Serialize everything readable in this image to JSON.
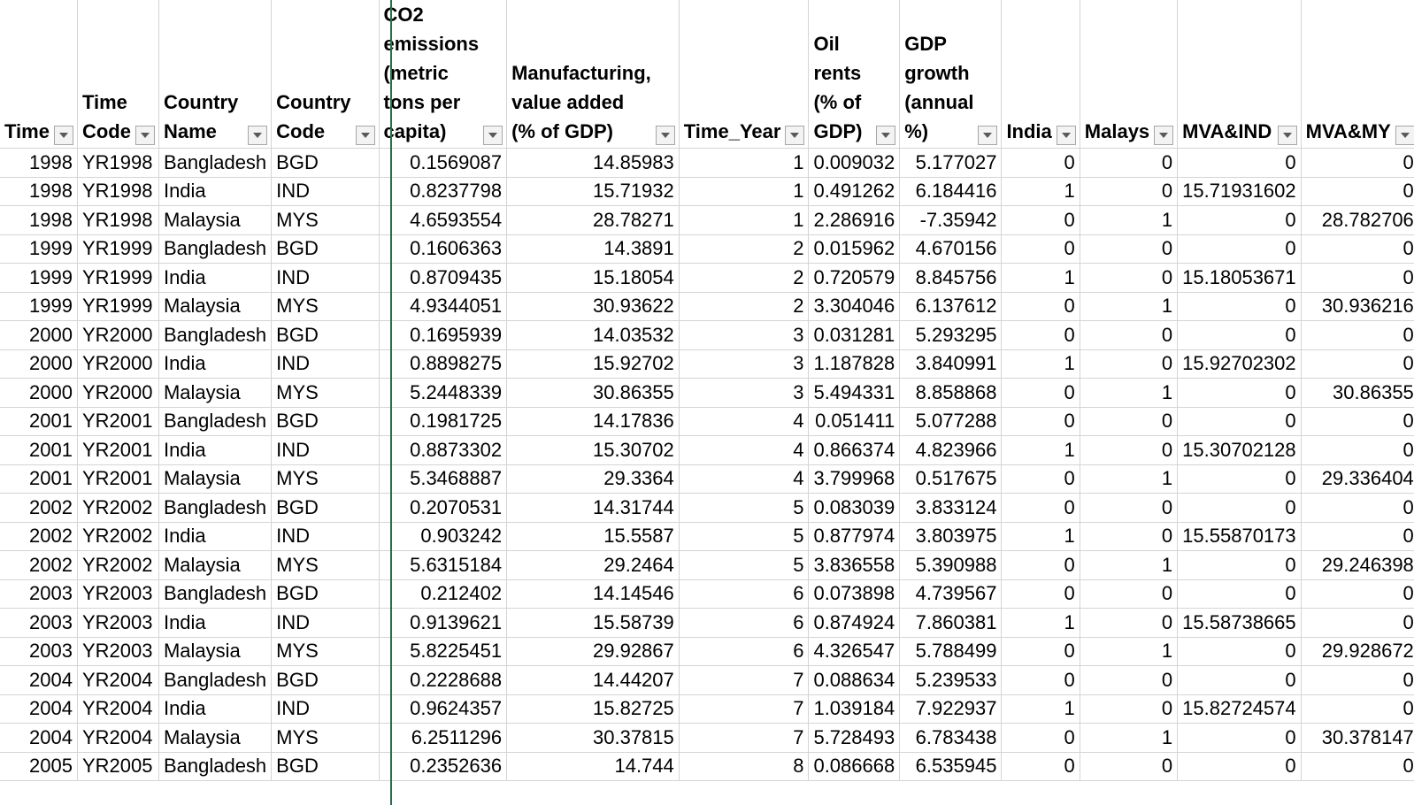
{
  "columns": [
    {
      "key": "time",
      "label": "Time",
      "align": "right"
    },
    {
      "key": "time_code",
      "label": "Time Code",
      "align": "left"
    },
    {
      "key": "country_name",
      "label": "Country Name",
      "align": "left"
    },
    {
      "key": "country_code",
      "label": "Country Code",
      "align": "left"
    },
    {
      "key": "co2",
      "label": "CO2 emissions (metric tons per capita)",
      "align": "right"
    },
    {
      "key": "manufacturing",
      "label": "Manufacturing, value added (% of GDP)",
      "align": "right"
    },
    {
      "key": "time_year",
      "label": "Time_Year",
      "align": "right"
    },
    {
      "key": "oil_rents",
      "label": "Oil rents (% of GDP)",
      "align": "right"
    },
    {
      "key": "gdp_growth",
      "label": "GDP growth (annual %)",
      "align": "right"
    },
    {
      "key": "india",
      "label": "India",
      "align": "right"
    },
    {
      "key": "malaysia",
      "label": "Malays",
      "align": "right"
    },
    {
      "key": "mva_ind",
      "label": "MVA&IND",
      "align": "right"
    },
    {
      "key": "mva_my",
      "label": "MVA&MY",
      "align": "right"
    }
  ],
  "rows": [
    [
      "1998",
      "YR1998",
      "Bangladesh",
      "BGD",
      "0.1569087",
      "14.85983",
      "1",
      "0.009032",
      "5.177027",
      "0",
      "0",
      "0",
      "0"
    ],
    [
      "1998",
      "YR1998",
      "India",
      "IND",
      "0.8237798",
      "15.71932",
      "1",
      "0.491262",
      "6.184416",
      "1",
      "0",
      "15.71931602",
      "0"
    ],
    [
      "1998",
      "YR1998",
      "Malaysia",
      "MYS",
      "4.6593554",
      "28.78271",
      "1",
      "2.286916",
      "-7.35942",
      "0",
      "1",
      "0",
      "28.782706"
    ],
    [
      "1999",
      "YR1999",
      "Bangladesh",
      "BGD",
      "0.1606363",
      "14.3891",
      "2",
      "0.015962",
      "4.670156",
      "0",
      "0",
      "0",
      "0"
    ],
    [
      "1999",
      "YR1999",
      "India",
      "IND",
      "0.8709435",
      "15.18054",
      "2",
      "0.720579",
      "8.845756",
      "1",
      "0",
      "15.18053671",
      "0"
    ],
    [
      "1999",
      "YR1999",
      "Malaysia",
      "MYS",
      "4.9344051",
      "30.93622",
      "2",
      "3.304046",
      "6.137612",
      "0",
      "1",
      "0",
      "30.936216"
    ],
    [
      "2000",
      "YR2000",
      "Bangladesh",
      "BGD",
      "0.1695939",
      "14.03532",
      "3",
      "0.031281",
      "5.293295",
      "0",
      "0",
      "0",
      "0"
    ],
    [
      "2000",
      "YR2000",
      "India",
      "IND",
      "0.8898275",
      "15.92702",
      "3",
      "1.187828",
      "3.840991",
      "1",
      "0",
      "15.92702302",
      "0"
    ],
    [
      "2000",
      "YR2000",
      "Malaysia",
      "MYS",
      "5.2448339",
      "30.86355",
      "3",
      "5.494331",
      "8.858868",
      "0",
      "1",
      "0",
      "30.86355"
    ],
    [
      "2001",
      "YR2001",
      "Bangladesh",
      "BGD",
      "0.1981725",
      "14.17836",
      "4",
      "0.051411",
      "5.077288",
      "0",
      "0",
      "0",
      "0"
    ],
    [
      "2001",
      "YR2001",
      "India",
      "IND",
      "0.8873302",
      "15.30702",
      "4",
      "0.866374",
      "4.823966",
      "1",
      "0",
      "15.30702128",
      "0"
    ],
    [
      "2001",
      "YR2001",
      "Malaysia",
      "MYS",
      "5.3468887",
      "29.3364",
      "4",
      "3.799968",
      "0.517675",
      "0",
      "1",
      "0",
      "29.336404"
    ],
    [
      "2002",
      "YR2002",
      "Bangladesh",
      "BGD",
      "0.2070531",
      "14.31744",
      "5",
      "0.083039",
      "3.833124",
      "0",
      "0",
      "0",
      "0"
    ],
    [
      "2002",
      "YR2002",
      "India",
      "IND",
      "0.903242",
      "15.5587",
      "5",
      "0.877974",
      "3.803975",
      "1",
      "0",
      "15.55870173",
      "0"
    ],
    [
      "2002",
      "YR2002",
      "Malaysia",
      "MYS",
      "5.6315184",
      "29.2464",
      "5",
      "3.836558",
      "5.390988",
      "0",
      "1",
      "0",
      "29.246398"
    ],
    [
      "2003",
      "YR2003",
      "Bangladesh",
      "BGD",
      "0.212402",
      "14.14546",
      "6",
      "0.073898",
      "4.739567",
      "0",
      "0",
      "0",
      "0"
    ],
    [
      "2003",
      "YR2003",
      "India",
      "IND",
      "0.9139621",
      "15.58739",
      "6",
      "0.874924",
      "7.860381",
      "1",
      "0",
      "15.58738665",
      "0"
    ],
    [
      "2003",
      "YR2003",
      "Malaysia",
      "MYS",
      "5.8225451",
      "29.92867",
      "6",
      "4.326547",
      "5.788499",
      "0",
      "1",
      "0",
      "29.928672"
    ],
    [
      "2004",
      "YR2004",
      "Bangladesh",
      "BGD",
      "0.2228688",
      "14.44207",
      "7",
      "0.088634",
      "5.239533",
      "0",
      "0",
      "0",
      "0"
    ],
    [
      "2004",
      "YR2004",
      "India",
      "IND",
      "0.9624357",
      "15.82725",
      "7",
      "1.039184",
      "7.922937",
      "1",
      "0",
      "15.82724574",
      "0"
    ],
    [
      "2004",
      "YR2004",
      "Malaysia",
      "MYS",
      "6.2511296",
      "30.37815",
      "7",
      "5.728493",
      "6.783438",
      "0",
      "1",
      "0",
      "30.378147"
    ],
    [
      "2005",
      "YR2005",
      "Bangladesh",
      "BGD",
      "0.2352636",
      "14.744",
      "8",
      "0.086668",
      "6.535945",
      "0",
      "0",
      "0",
      "0"
    ]
  ]
}
